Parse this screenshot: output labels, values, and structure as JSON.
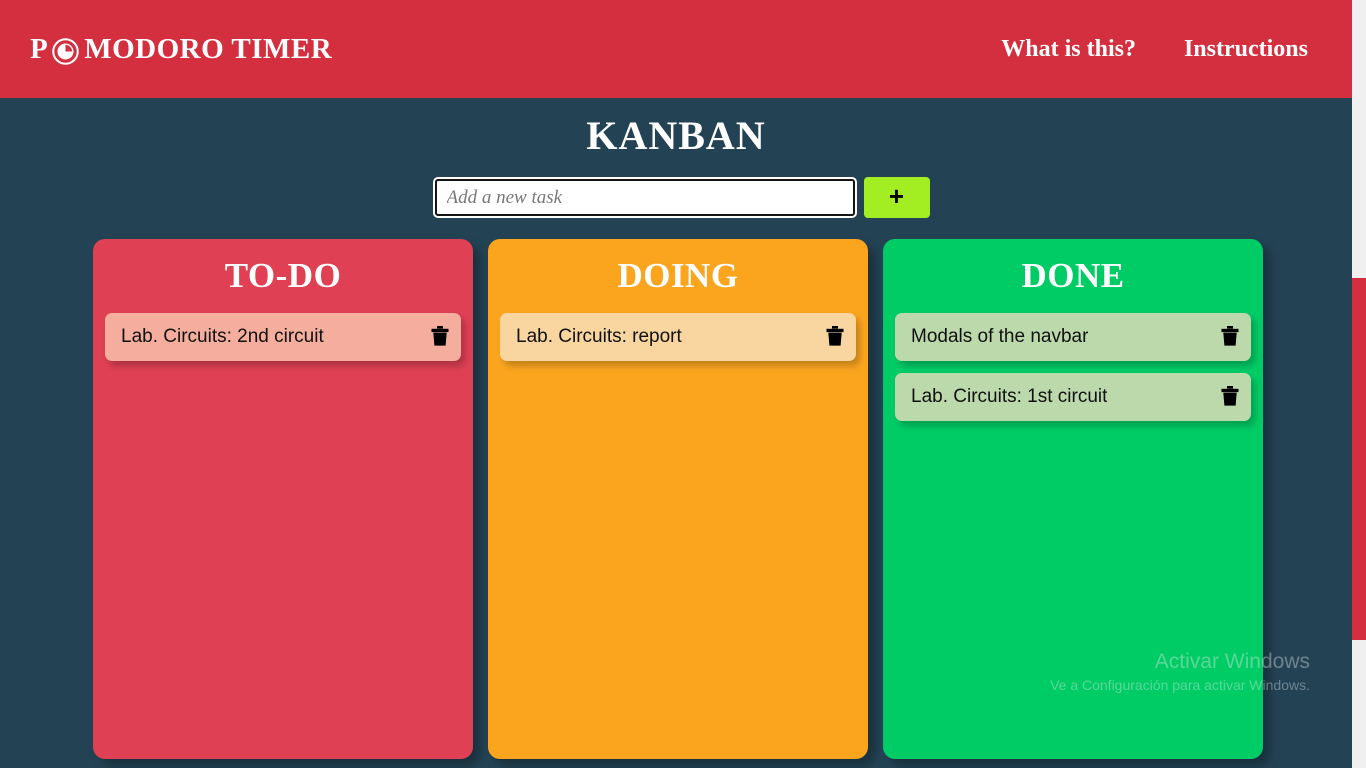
{
  "navbar": {
    "brand_p": "P",
    "brand_rest": "MODORO TIMER",
    "logo_icon": "clock-icon",
    "links": [
      {
        "label": "What is this?",
        "name": "nav-link-what-is-this"
      },
      {
        "label": "Instructions",
        "name": "nav-link-instructions"
      }
    ]
  },
  "main": {
    "title": "KANBAN",
    "form": {
      "input_placeholder": "Add a new task",
      "input_value": "",
      "add_button_label": "+"
    }
  },
  "board": {
    "columns": [
      {
        "title": "TO-DO",
        "color": "#DF4054",
        "card_color": "#F5AE9D",
        "cards": [
          {
            "text": "Lab. Circuits: 2nd circuit",
            "delete_icon": "trash-icon"
          }
        ]
      },
      {
        "title": "DOING",
        "color": "#FBA51F",
        "card_color": "#F9D5A0",
        "cards": [
          {
            "text": "Lab. Circuits: report",
            "delete_icon": "trash-icon"
          }
        ]
      },
      {
        "title": "DONE",
        "color": "#00CC66",
        "card_color": "#BCD9AC",
        "cards": [
          {
            "text": "Modals of the navbar",
            "delete_icon": "trash-icon"
          },
          {
            "text": "Lab. Circuits: 1st circuit",
            "delete_icon": "trash-icon"
          }
        ]
      }
    ]
  },
  "watermark": {
    "title": "Activar Windows",
    "subtitle": "Ve a Configuración para activar Windows."
  },
  "colors": {
    "navbar": "#D32F3E",
    "background": "#234355",
    "accent_green": "#A3EE22",
    "scrollbar_thumb": "#D32F3E",
    "scrollbar_track": "#F0F0F0"
  }
}
